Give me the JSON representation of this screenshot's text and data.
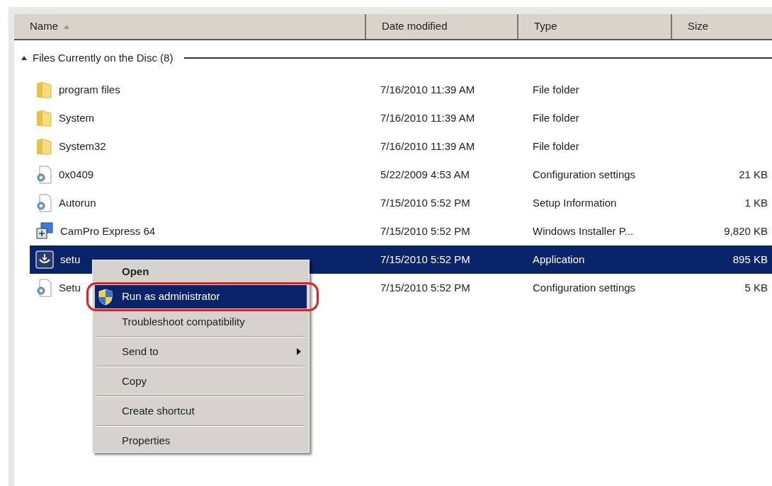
{
  "columns": [
    {
      "label": "Name",
      "sorted": true
    },
    {
      "label": "Date modified",
      "sorted": false
    },
    {
      "label": "Type",
      "sorted": false
    },
    {
      "label": "Size",
      "sorted": false
    }
  ],
  "group": {
    "label": "Files Currently on the Disc (8)",
    "expanded": true
  },
  "rows": [
    {
      "kind": "folder",
      "name": "program files",
      "date": "7/16/2010 11:39 AM",
      "type": "File folder",
      "size": "",
      "selected": false
    },
    {
      "kind": "folder",
      "name": "System",
      "date": "7/16/2010 11:39 AM",
      "type": "File folder",
      "size": "",
      "selected": false
    },
    {
      "kind": "folder",
      "name": "System32",
      "date": "7/16/2010 11:39 AM",
      "type": "File folder",
      "size": "",
      "selected": false
    },
    {
      "kind": "config",
      "name": "0x0409",
      "date": "5/22/2009 4:53 AM",
      "type": "Configuration settings",
      "size": "21 KB",
      "selected": false
    },
    {
      "kind": "config",
      "name": "Autorun",
      "date": "7/15/2010 5:52 PM",
      "type": "Setup Information",
      "size": "1 KB",
      "selected": false
    },
    {
      "kind": "installer",
      "name": "CamPro Express 64",
      "date": "7/15/2010 5:52 PM",
      "type": "Windows Installer P...",
      "size": "9,820 KB",
      "selected": false
    },
    {
      "kind": "app",
      "name": "setu",
      "date": "7/15/2010 5:52 PM",
      "type": "Application",
      "size": "895 KB",
      "selected": true
    },
    {
      "kind": "config",
      "name": "Setu",
      "date": "7/15/2010 5:52 PM",
      "type": "Configuration settings",
      "size": "5 KB",
      "selected": false
    }
  ],
  "context_menu": {
    "items": [
      {
        "kind": "item",
        "label": "Open",
        "bold": true,
        "selected": false,
        "submenu": false
      },
      {
        "kind": "shield-item",
        "label": "Run as administrator",
        "bold": false,
        "selected": true,
        "submenu": false
      },
      {
        "kind": "item",
        "label": "Troubleshoot compatibility",
        "bold": false,
        "selected": false,
        "submenu": false
      },
      {
        "kind": "separator"
      },
      {
        "kind": "item",
        "label": "Send to",
        "bold": false,
        "selected": false,
        "submenu": true
      },
      {
        "kind": "separator"
      },
      {
        "kind": "item",
        "label": "Copy",
        "bold": false,
        "selected": false,
        "submenu": false
      },
      {
        "kind": "separator"
      },
      {
        "kind": "item",
        "label": "Create shortcut",
        "bold": false,
        "selected": false,
        "submenu": false
      },
      {
        "kind": "separator"
      },
      {
        "kind": "item",
        "label": "Properties",
        "bold": false,
        "selected": false,
        "submenu": false
      }
    ]
  }
}
